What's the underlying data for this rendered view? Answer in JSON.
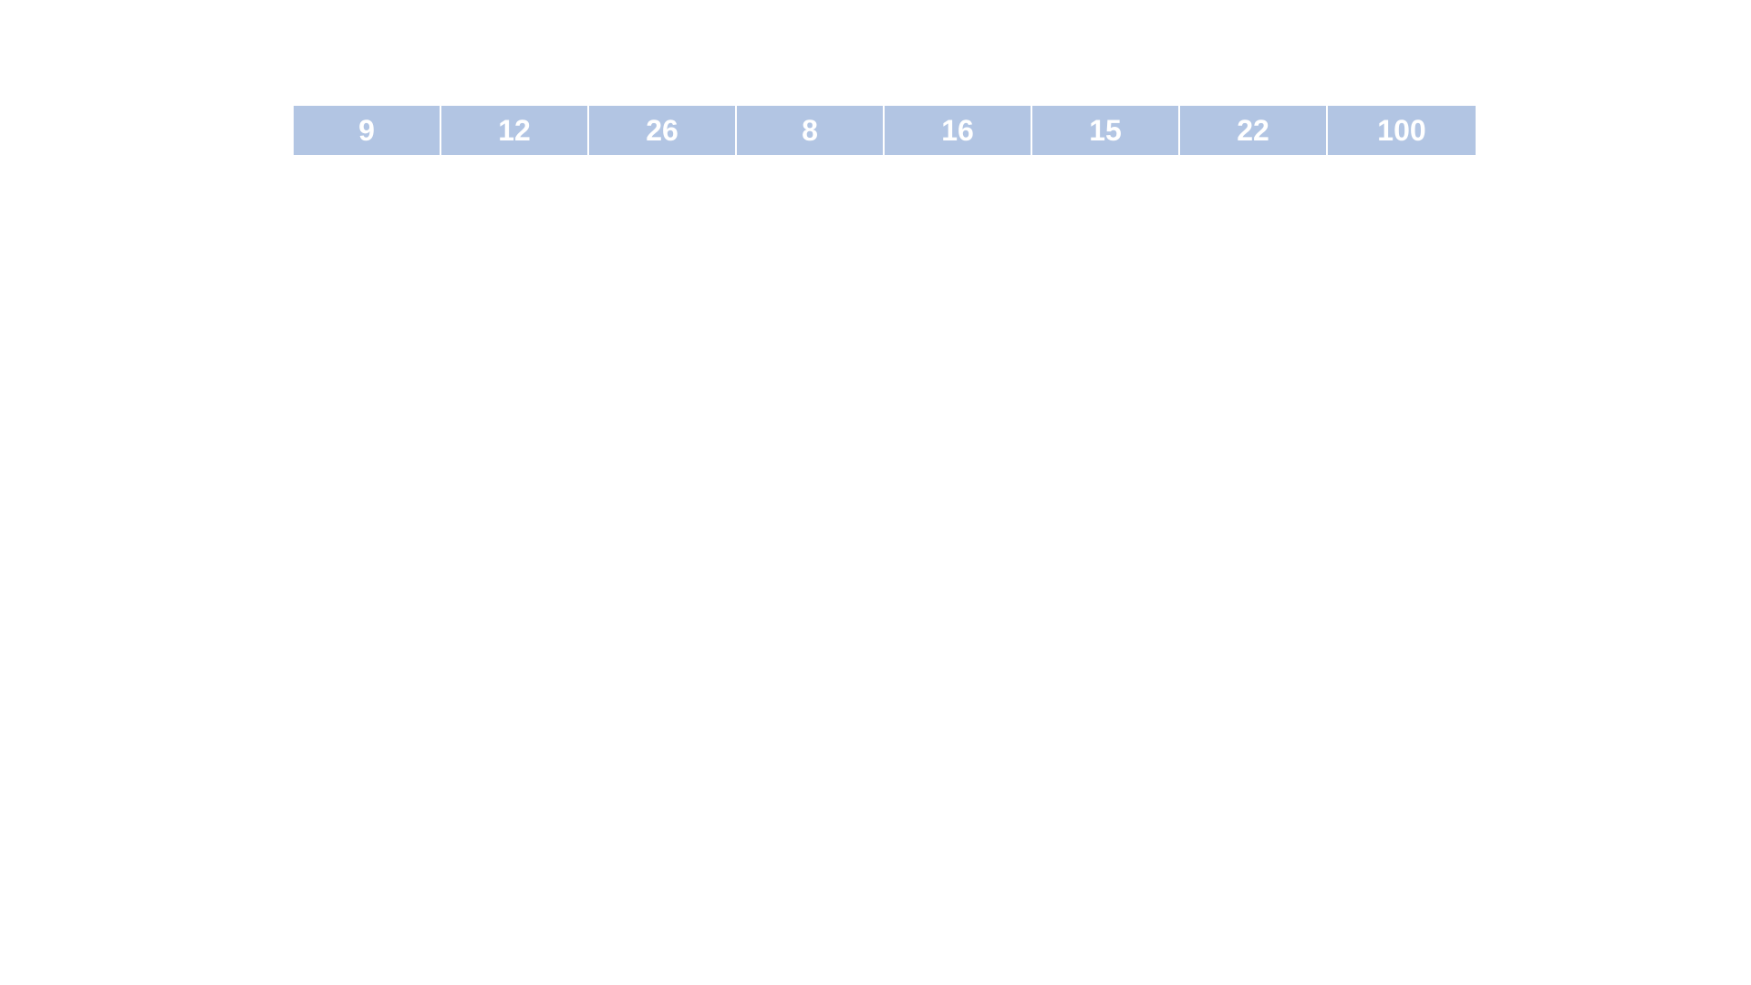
{
  "row": {
    "cells": [
      {
        "value": "9"
      },
      {
        "value": "12"
      },
      {
        "value": "26"
      },
      {
        "value": "8"
      },
      {
        "value": "16"
      },
      {
        "value": "15"
      },
      {
        "value": "22"
      },
      {
        "value": "100"
      }
    ]
  }
}
